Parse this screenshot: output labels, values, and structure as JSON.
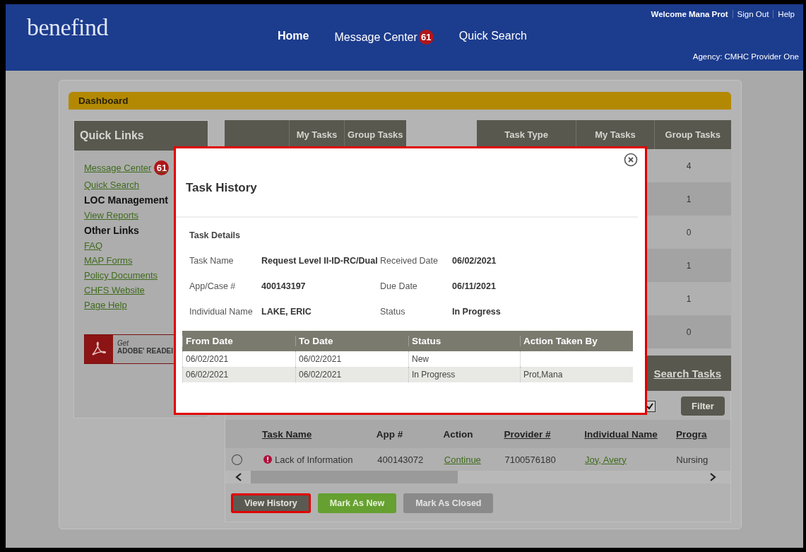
{
  "header": {
    "logo": "benefind",
    "nav": [
      {
        "label": "Home",
        "selected": true
      },
      {
        "label": "Message Center",
        "badge": "61",
        "selected": false
      },
      {
        "label": "Quick Search",
        "selected": false
      }
    ],
    "user_links": [
      "Welcome Mana Prot",
      "Sign Out",
      "Help"
    ],
    "agency": "Agency: CMHC Provider One"
  },
  "dashboard": {
    "title": "Dashboard",
    "quick_links": {
      "title": "Quick Links",
      "items": [
        {
          "kind": "link",
          "label": "Message Center",
          "badge": "61"
        },
        {
          "kind": "link",
          "label": "Quick Search"
        },
        {
          "kind": "heading",
          "label": "LOC Management"
        },
        {
          "kind": "link",
          "label": "View Reports"
        },
        {
          "kind": "heading",
          "label": "Other Links"
        },
        {
          "kind": "link",
          "label": "FAQ"
        },
        {
          "kind": "link",
          "label": "MAP Forms"
        },
        {
          "kind": "link",
          "label": "Policy Documents"
        },
        {
          "kind": "link",
          "label": "CHFS Website"
        },
        {
          "kind": "link",
          "label": "Page Help"
        }
      ],
      "adobe": {
        "small": "Get",
        "big": "ADOBE' READEI"
      }
    },
    "summary_left": {
      "columns": [
        "My Tasks",
        "Group Tasks"
      ]
    },
    "summary_right": {
      "columns": [
        "Task Type",
        "My Tasks",
        "Group Tasks"
      ],
      "group_tasks": [
        "4",
        "1",
        "0",
        "1",
        "1",
        "0"
      ]
    },
    "search_tasks": "Search Tasks",
    "filter": {
      "checked": true,
      "button": "Filter"
    },
    "tasks": {
      "columns": [
        {
          "label": "Task Name",
          "link": true
        },
        {
          "label": "App #",
          "link": false
        },
        {
          "label": "Action",
          "link": false
        },
        {
          "label": "Provider #",
          "link": true
        },
        {
          "label": "Individual Name",
          "link": true
        },
        {
          "label": "Progra",
          "link": true
        }
      ],
      "rows": [
        {
          "selected": false,
          "alert": true,
          "task_name": "Lack of Information",
          "app": "400143072",
          "action": "Continue",
          "provider": "7100576180",
          "individual": "Joy, Avery",
          "program": "Nursing"
        }
      ]
    },
    "buttons": [
      {
        "label": "View History",
        "kind": "dark",
        "highlighted": true,
        "disabled": false
      },
      {
        "label": "Mark As New",
        "kind": "green",
        "highlighted": false,
        "disabled": false
      },
      {
        "label": "Mark As Closed",
        "kind": "dark",
        "highlighted": false,
        "disabled": true
      }
    ]
  },
  "modal": {
    "title": "Task History",
    "section": "Task Details",
    "details": [
      [
        "Task Name",
        "Request Level II-ID-RC/Dual",
        "Received Date",
        "06/02/2021"
      ],
      [
        "App/Case #",
        "400143197",
        "Due Date",
        "06/11/2021"
      ],
      [
        "Individual Name",
        "LAKE, ERIC",
        "Status",
        "In Progress"
      ]
    ],
    "history": {
      "columns": [
        "From Date",
        "To Date",
        "Status",
        "Action Taken By"
      ],
      "rows": [
        [
          "06/02/2021",
          "06/02/2021",
          "New",
          ""
        ],
        [
          "06/02/2021",
          "06/02/2021",
          "In Progress",
          "Prot,Mana"
        ]
      ]
    }
  }
}
